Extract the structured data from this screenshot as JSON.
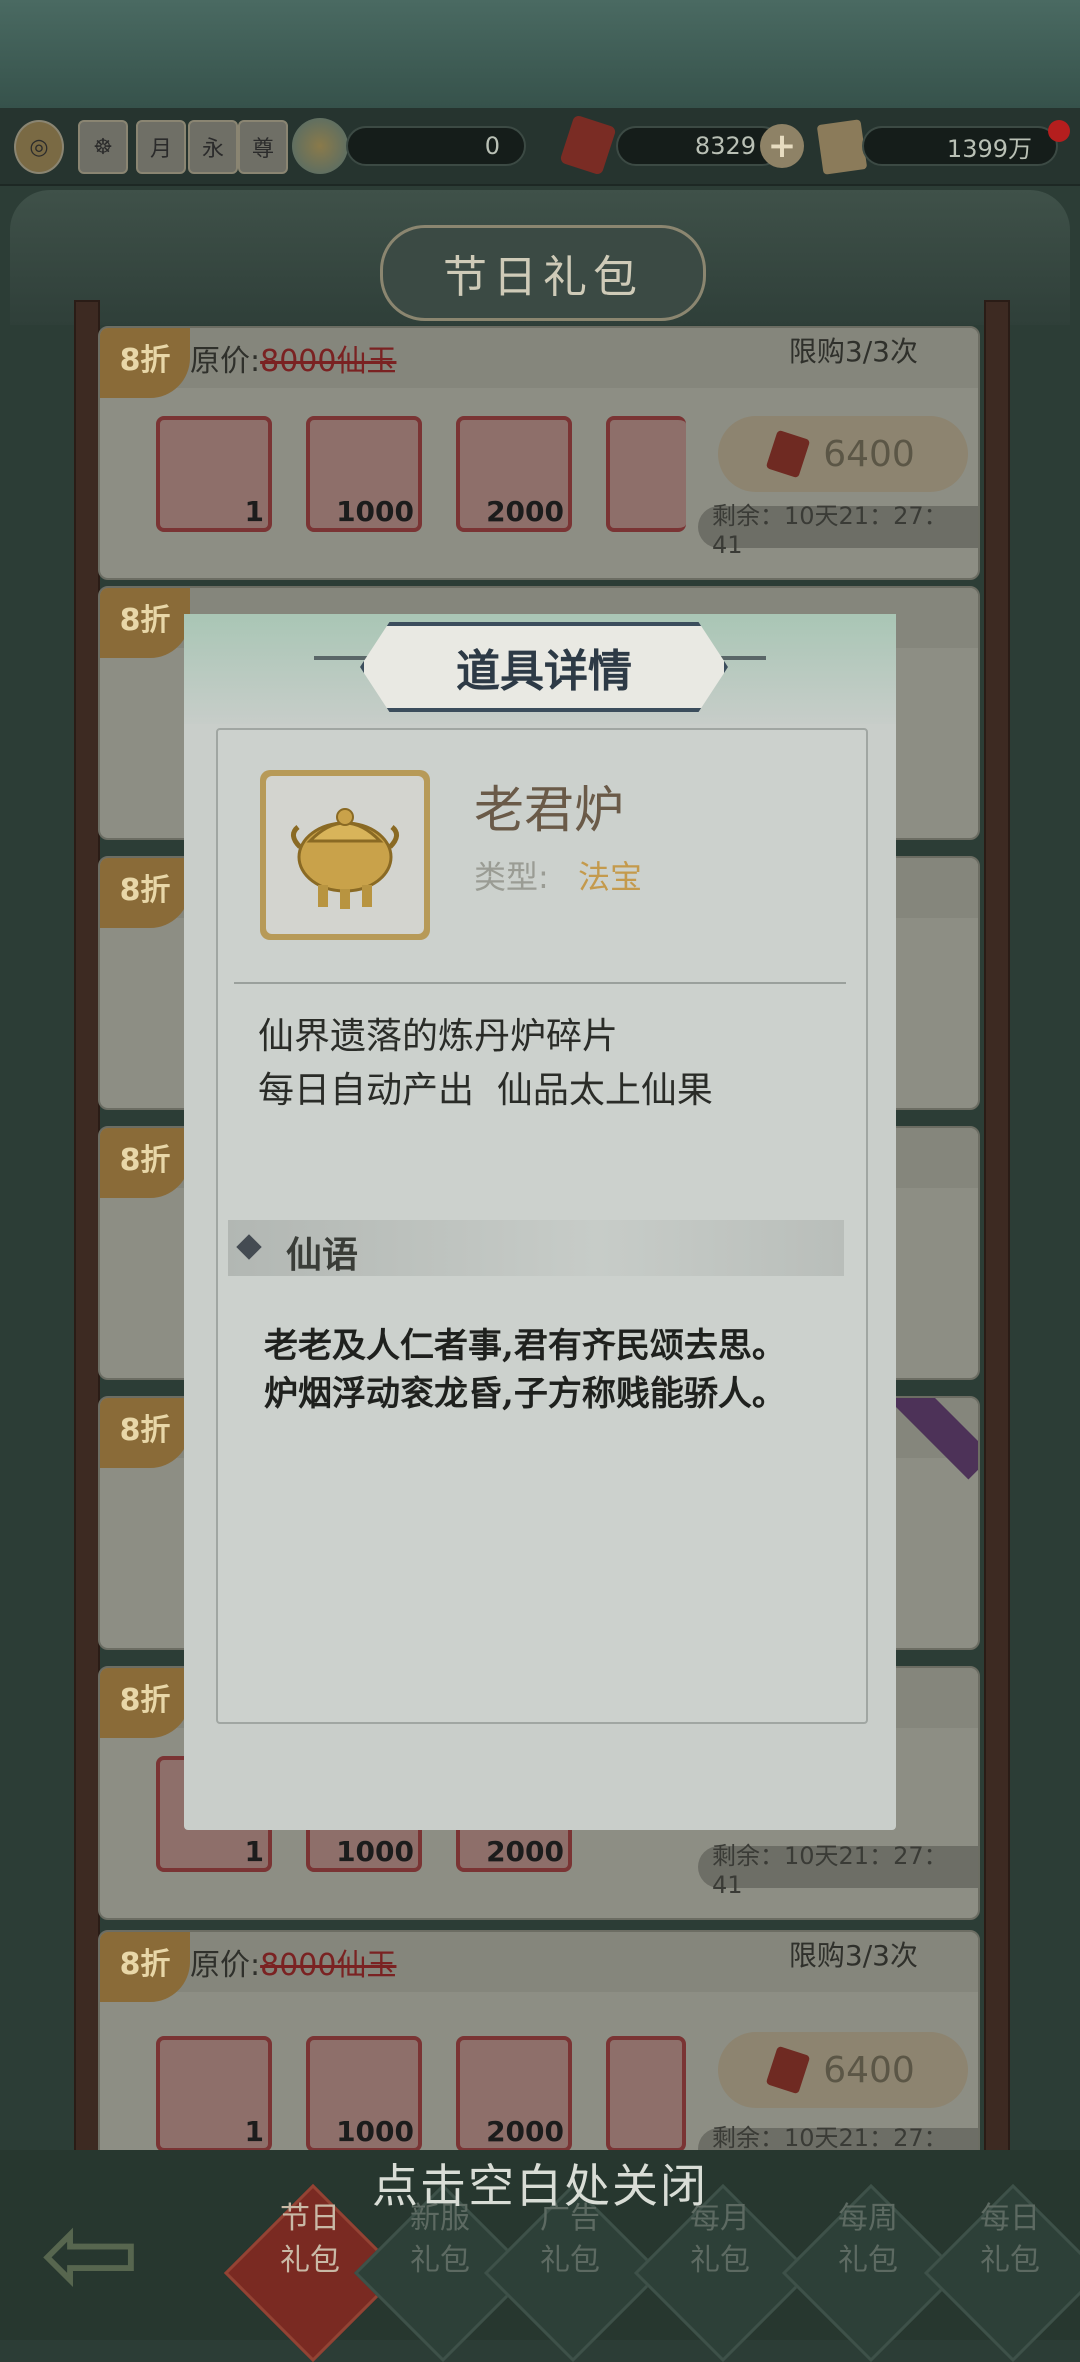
{
  "resources": {
    "top_icons": [
      "coin-icon",
      "mask-icon",
      "月",
      "永",
      "尊"
    ],
    "spiral_value": "0",
    "gem_value": "8329",
    "scroll_value": "1399万"
  },
  "header": {
    "title": "节日礼包"
  },
  "cards": [
    {
      "discount": "8折",
      "orig_label": "原价:",
      "orig_price": "8000仙玉",
      "limit": "限购3/3次",
      "items": [
        "1",
        "1000",
        "2000",
        ""
      ],
      "price": "6400",
      "remain": "剩余：10天21：27：41"
    },
    {
      "discount": "8折",
      "orig_label": "原价:",
      "orig_price": "8000仙玉",
      "limit": "限购3/3次",
      "items": [
        "1",
        "1000",
        "2000",
        ""
      ],
      "price": "6400",
      "remain": "剩余：10天21：27：41"
    }
  ],
  "bottom_nav": {
    "close_hint": "点击空白处关闭",
    "tabs": [
      "节日\n礼包",
      "新服\n礼包",
      "广告\n礼包",
      "每月\n礼包",
      "每周\n礼包",
      "每日\n礼包"
    ]
  },
  "modal": {
    "title": "道具详情",
    "item_name": "老君炉",
    "type_label": "类型:",
    "type_value": "法宝",
    "desc_line1": "仙界遗落的炼丹炉碎片",
    "desc_line2": "每日自动产出  仙品太上仙果",
    "section_title": "仙语",
    "poem_line1": "老老及人仁者事,君有齐民颂去思。",
    "poem_line2": "炉烟浮动衮龙昏,子方称贱能骄人。"
  },
  "colors": {
    "accent_gold": "#c49a4c",
    "strike_red": "#7a2222"
  }
}
